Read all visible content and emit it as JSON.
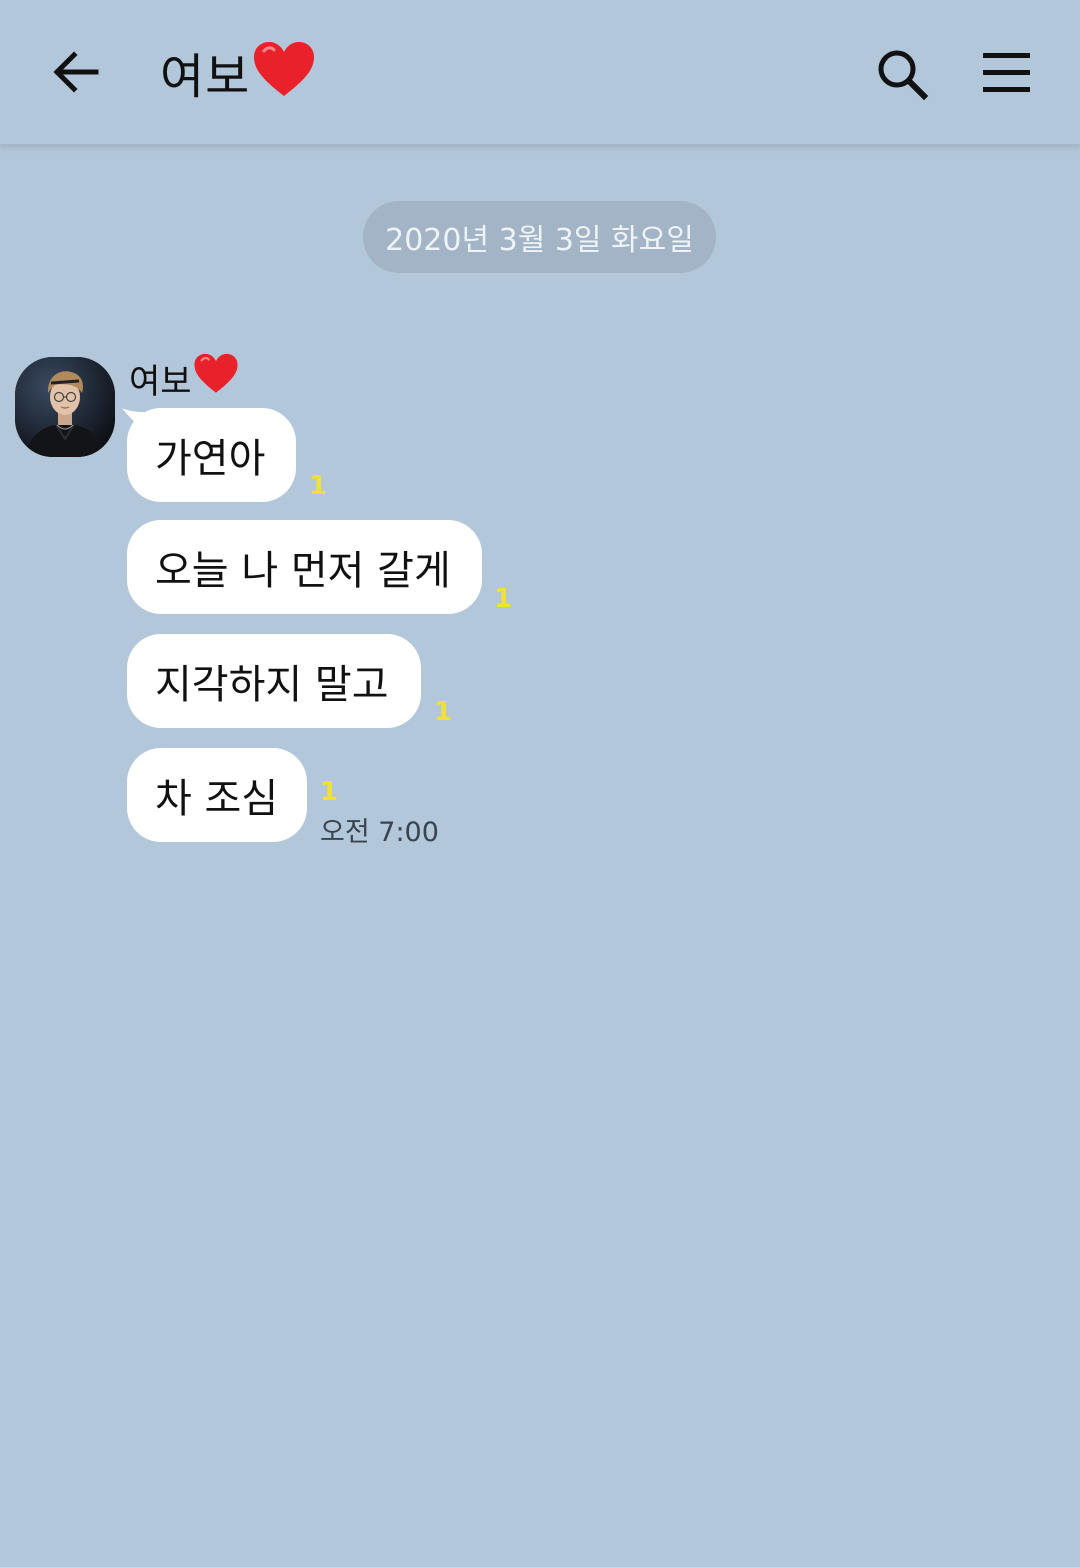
{
  "header": {
    "title": "여보",
    "title_emoji": "heart-icon",
    "icons": [
      "back-arrow-icon",
      "search-icon",
      "menu-icon"
    ]
  },
  "date_divider": "2020년 3월 3일 화요일",
  "sender": {
    "name": "여보",
    "avatar": "profile-photo"
  },
  "messages": [
    {
      "text": "가연아",
      "unread": "1"
    },
    {
      "text": "오늘 나 먼저 갈게",
      "unread": "1"
    },
    {
      "text": "지각하지 말고",
      "unread": "1"
    },
    {
      "text": "차 조심",
      "unread": "1",
      "time": "오전 7:00"
    }
  ],
  "colors": {
    "background": "#b2c7da",
    "bubble": "#ffffff",
    "unread": "#f1df3a",
    "date_pill": "#a2b4c5",
    "heart": "#e8212a"
  }
}
